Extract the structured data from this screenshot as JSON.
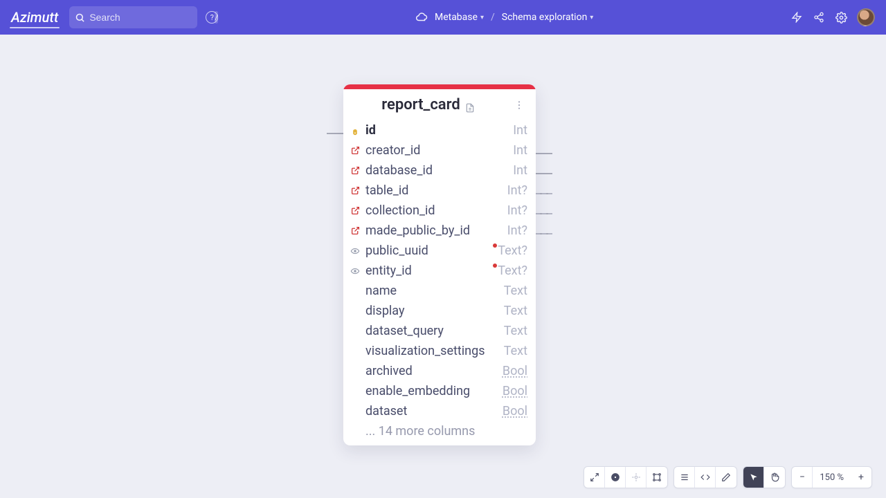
{
  "header": {
    "logo": "Azimutt",
    "search_placeholder": "Search",
    "kbd": "/",
    "breadcrumb": {
      "project": "Metabase",
      "view": "Schema exploration"
    }
  },
  "table": {
    "name": "report_card",
    "columns": [
      {
        "icon": "key",
        "name": "id",
        "type": "Int",
        "pk": true,
        "dot": false,
        "under": false
      },
      {
        "icon": "fk",
        "name": "creator_id",
        "type": "Int",
        "pk": false,
        "dot": false,
        "under": false
      },
      {
        "icon": "fk",
        "name": "database_id",
        "type": "Int",
        "pk": false,
        "dot": false,
        "under": false
      },
      {
        "icon": "fk",
        "name": "table_id",
        "type": "Int?",
        "pk": false,
        "dot": false,
        "under": false
      },
      {
        "icon": "fk",
        "name": "collection_id",
        "type": "Int?",
        "pk": false,
        "dot": false,
        "under": false
      },
      {
        "icon": "fk",
        "name": "made_public_by_id",
        "type": "Int?",
        "pk": false,
        "dot": false,
        "under": false
      },
      {
        "icon": "idx",
        "name": "public_uuid",
        "type": "Text?",
        "pk": false,
        "dot": true,
        "under": false
      },
      {
        "icon": "idx",
        "name": "entity_id",
        "type": "Text?",
        "pk": false,
        "dot": true,
        "under": false
      },
      {
        "icon": "",
        "name": "name",
        "type": "Text",
        "pk": false,
        "dot": false,
        "under": false
      },
      {
        "icon": "",
        "name": "display",
        "type": "Text",
        "pk": false,
        "dot": false,
        "under": false
      },
      {
        "icon": "",
        "name": "dataset_query",
        "type": "Text",
        "pk": false,
        "dot": false,
        "under": false
      },
      {
        "icon": "",
        "name": "visualization_settings",
        "type": "Text",
        "pk": false,
        "dot": false,
        "under": false
      },
      {
        "icon": "",
        "name": "archived",
        "type": "Bool",
        "pk": false,
        "dot": false,
        "under": true
      },
      {
        "icon": "",
        "name": "enable_embedding",
        "type": "Bool",
        "pk": false,
        "dot": false,
        "under": true
      },
      {
        "icon": "",
        "name": "dataset",
        "type": "Bool",
        "pk": false,
        "dot": false,
        "under": true
      }
    ],
    "more": "... 14 more columns"
  },
  "toolbar": {
    "zoom": "150 %"
  }
}
